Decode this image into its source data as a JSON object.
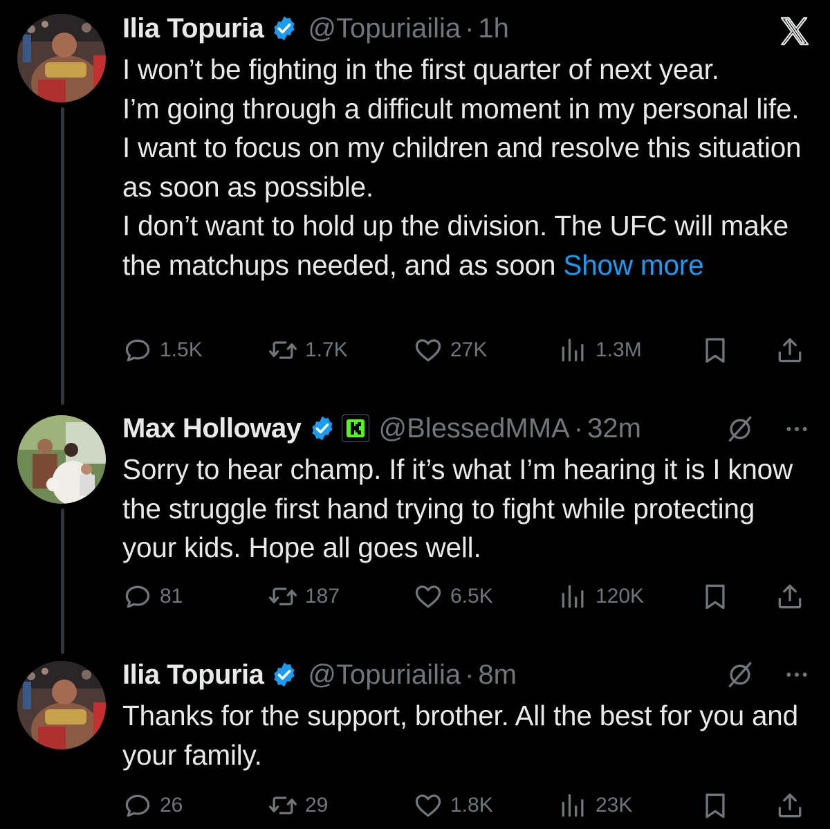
{
  "brand": {
    "logo_icon": "x-logo-icon"
  },
  "colors": {
    "background": "#000000",
    "text": "#e7e9ea",
    "secondary": "#71767b",
    "accent": "#1d9bf0",
    "verified": "#1d9bf0"
  },
  "tweets": [
    {
      "name": "Ilia Topuria",
      "handle": "@Topuriailia",
      "dot": "·",
      "time": "1h",
      "text": "I won’t be fighting in the first quarter of next year.\nI’m going through a difficult moment in my personal life. I want to focus on my children and resolve this situation as soon as possible.\nI don’t want to hold up the division. The UFC will make the matchups needed, and as soon ",
      "show_more": "Show more",
      "replies": "1.5K",
      "reposts": "1.7K",
      "likes": "27K",
      "views": "1.3M"
    },
    {
      "name": "Max Holloway",
      "handle": "@BlessedMMA",
      "dot": "·",
      "time": "32m",
      "badge": "K",
      "text": "Sorry to hear champ. If it’s what I’m hearing it is I know the struggle first hand trying to fight while protecting your kids. Hope all goes well.",
      "replies": "81",
      "reposts": "187",
      "likes": "6.5K",
      "views": "120K"
    },
    {
      "name": "Ilia Topuria",
      "handle": "@Topuriailia",
      "dot": "·",
      "time": "8m",
      "text": "Thanks for the support, brother. All the best for you and your family.",
      "replies": "26",
      "reposts": "29",
      "likes": "1.8K",
      "views": "23K"
    }
  ]
}
